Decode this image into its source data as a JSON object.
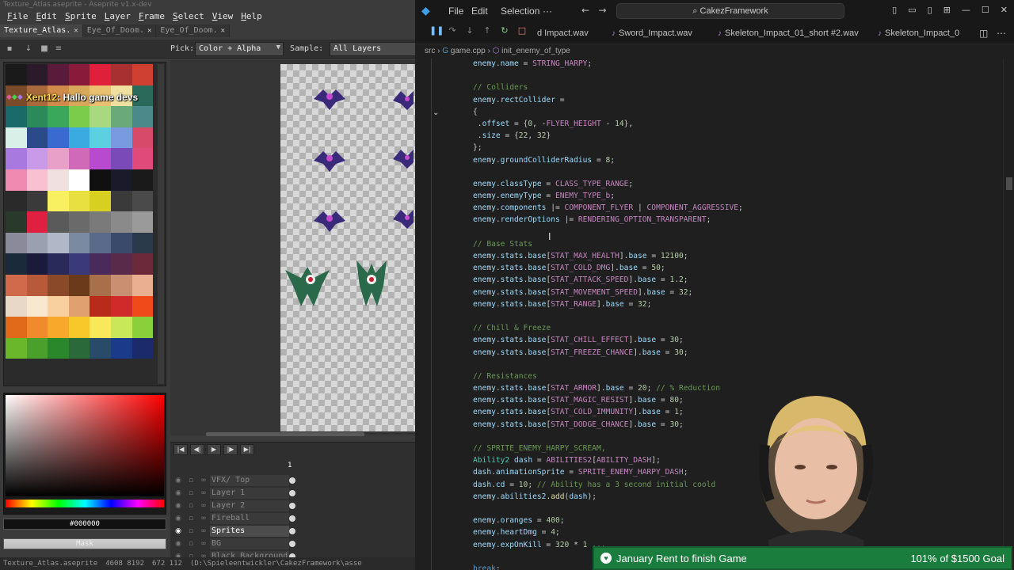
{
  "aseprite": {
    "window_title": "Texture_Atlas.aseprite - Aseprite v1.x-dev",
    "menu": [
      "File",
      "Edit",
      "Sprite",
      "Layer",
      "Frame",
      "Select",
      "View",
      "Help"
    ],
    "tabs": [
      {
        "label": "Texture_Atlas.",
        "active": true
      },
      {
        "label": "Eye_Of_Doom.",
        "active": false
      },
      {
        "label": "Eye_Of_Doom.",
        "active": false
      }
    ],
    "toolbar": {
      "pick_label": "Pick:",
      "pick_value": "Color + Alpha",
      "sample_label": "Sample:",
      "sample_value": "All Layers"
    },
    "palette": [
      "#1a1a1a",
      "#2a1a2a",
      "#5a1a3a",
      "#8a1a3a",
      "#e0203a",
      "#a83030",
      "#d04030",
      "#7a4a2a",
      "#a86a3a",
      "#d08a4a",
      "#d8a85a",
      "#e8c070",
      "#f0e0a0",
      "#2a6a5a",
      "#1a6a6a",
      "#2a8a5a",
      "#3aa85a",
      "#7acc4a",
      "#a8d880",
      "#6aaa7a",
      "#4a8a8a",
      "#d8f0e8",
      "#2a4a8a",
      "#3a6ad0",
      "#3aaae0",
      "#5ad0e0",
      "#7a9ae0",
      "#d84a6a",
      "#a87ae0",
      "#c89ae8",
      "#e8a0c8",
      "#d06ab8",
      "#b84ad0",
      "#7a4ab8",
      "#e04a7a",
      "#f08ab0",
      "#f8c0d0",
      "#f0e0e0",
      "#ffffff",
      "#101010",
      "#1a1a2a",
      "#1a1a1a",
      "#2a2a2a",
      "#3a3a3a",
      "#f8f060",
      "#e8e040",
      "#d8d020",
      "#3a3a3a",
      "#4a4a4a",
      "#2a3a2a",
      "#e02040",
      "#5a5a5a",
      "#6a6a6a",
      "#7a7a7a",
      "#8a8a8a",
      "#9a9a9a",
      "#8a8a9a",
      "#9aa0b0",
      "#b0b8c8",
      "#7a8aa0",
      "#5a6a8a",
      "#3a4a6a",
      "#2a3a4a",
      "#1a2a3a",
      "#1a1a3a",
      "#2a2a5a",
      "#3a3a7a",
      "#4a2a5a",
      "#5a2a4a",
      "#6a2a3a",
      "#d06a4a",
      "#b85a3a",
      "#8a4a2a",
      "#6a3a1a",
      "#a8704a",
      "#c89070",
      "#e8b090",
      "#e8d8c8",
      "#f8e8d0",
      "#f8d0a0",
      "#e0a070",
      "#b82a1a",
      "#d02a2a",
      "#f04a1a",
      "#e06a1a",
      "#f08a2a",
      "#f8a82a",
      "#f8c82a",
      "#f8e85a",
      "#c8e85a",
      "#8ad03a",
      "#6ab82a",
      "#4aa02a",
      "#2a882a",
      "#2a6a3a",
      "#2a4a6a",
      "#1a3a8a",
      "#1a2a6a"
    ],
    "chat": {
      "user": "Xent12",
      "message": ": Hallo game devs"
    },
    "color_hex": "#000000",
    "mask_label": "Mask",
    "timeline": {
      "frame_number": "1",
      "layers": [
        {
          "name": "VFX/ Top",
          "active": false
        },
        {
          "name": "Layer 1",
          "active": false
        },
        {
          "name": "Layer 2",
          "active": false
        },
        {
          "name": "Fireball",
          "active": false
        },
        {
          "name": "Sprites",
          "active": true
        },
        {
          "name": "BG",
          "active": false
        },
        {
          "name": "Black Background",
          "active": false
        }
      ]
    },
    "status": {
      "file": "Texture_Atlas.aseprite",
      "size": "4608 8192",
      "pos": "672 112",
      "path": "(D:\\Spieleentwickler\\CakezFramework\\asse"
    }
  },
  "vscode": {
    "menu": [
      "File",
      "Edit",
      "Selection",
      "···"
    ],
    "search": "CakezFramework",
    "tabs": [
      "d Impact.wav",
      "Sword_Impact.wav",
      "Skeleton_Impact_01_short #2.wav",
      "Skeleton_Impact_0"
    ],
    "breadcrumb": {
      "folder": "src",
      "file": "game.cpp",
      "symbol": "init_enemy_of_type"
    },
    "code_lines": [
      [
        [
          "c-var",
          "enemy"
        ],
        [
          "",
          "."
        ],
        [
          "c-var",
          "name"
        ],
        [
          "",
          " = "
        ],
        [
          "c-const",
          "STRING_HARPY"
        ],
        [
          "",
          ";"
        ]
      ],
      [],
      [
        [
          "c-com",
          "// Colliders"
        ]
      ],
      [
        [
          "c-var",
          "enemy"
        ],
        [
          "",
          "."
        ],
        [
          "c-var",
          "rectCollider"
        ],
        [
          "",
          " ="
        ]
      ],
      [
        [
          "",
          "{"
        ]
      ],
      [
        [
          "",
          " ."
        ],
        [
          "c-var",
          "offset"
        ],
        [
          "",
          " = {"
        ],
        [
          "c-num",
          "0"
        ],
        [
          "",
          ", -"
        ],
        [
          "c-const",
          "FLYER_HEIGHT"
        ],
        [
          "",
          " - "
        ],
        [
          "c-num",
          "14"
        ],
        [
          "",
          "},"
        ]
      ],
      [
        [
          "",
          " ."
        ],
        [
          "c-var",
          "size"
        ],
        [
          "",
          " = {"
        ],
        [
          "c-num",
          "22"
        ],
        [
          "",
          ", "
        ],
        [
          "c-num",
          "32"
        ],
        [
          "",
          "}"
        ]
      ],
      [
        [
          "",
          "};"
        ]
      ],
      [
        [
          "c-var",
          "enemy"
        ],
        [
          "",
          "."
        ],
        [
          "c-var",
          "groundColliderRadius"
        ],
        [
          "",
          " = "
        ],
        [
          "c-num",
          "8"
        ],
        [
          "",
          ";"
        ]
      ],
      [],
      [
        [
          "c-var",
          "enemy"
        ],
        [
          "",
          "."
        ],
        [
          "c-var",
          "classType"
        ],
        [
          "",
          " = "
        ],
        [
          "c-const",
          "CLASS_TYPE_RANGE"
        ],
        [
          "",
          ";"
        ]
      ],
      [
        [
          "c-var",
          "enemy"
        ],
        [
          "",
          "."
        ],
        [
          "c-var",
          "enemyType"
        ],
        [
          "",
          " = "
        ],
        [
          "c-const",
          "ENEMY_TYPE_b"
        ],
        [
          "",
          ";"
        ]
      ],
      [
        [
          "c-var",
          "enemy"
        ],
        [
          "",
          "."
        ],
        [
          "c-var",
          "components"
        ],
        [
          "",
          " |= "
        ],
        [
          "c-const",
          "COMPONENT_FLYER"
        ],
        [
          "",
          " | "
        ],
        [
          "c-const",
          "COMPONENT_AGGRESSIVE"
        ],
        [
          "",
          ";"
        ]
      ],
      [
        [
          "c-var",
          "enemy"
        ],
        [
          "",
          "."
        ],
        [
          "c-var",
          "renderOptions"
        ],
        [
          "",
          " |= "
        ],
        [
          "c-const",
          "RENDERING_OPTION_TRANSPARENT"
        ],
        [
          "",
          ";"
        ]
      ],
      [],
      [
        [
          "c-com",
          "// Base Stats"
        ]
      ],
      [
        [
          "c-var",
          "enemy"
        ],
        [
          "",
          "."
        ],
        [
          "c-var",
          "stats"
        ],
        [
          "",
          "."
        ],
        [
          "c-var",
          "base"
        ],
        [
          "",
          "["
        ],
        [
          "c-const",
          "STAT_MAX_HEALTH"
        ],
        [
          "",
          "]."
        ],
        [
          "c-var",
          "base"
        ],
        [
          "",
          " = "
        ],
        [
          "c-num",
          "12100"
        ],
        [
          "",
          ";"
        ]
      ],
      [
        [
          "c-var",
          "enemy"
        ],
        [
          "",
          "."
        ],
        [
          "c-var",
          "stats"
        ],
        [
          "",
          "."
        ],
        [
          "c-var",
          "base"
        ],
        [
          "",
          "["
        ],
        [
          "c-const",
          "STAT_COLD_DMG"
        ],
        [
          "",
          "]."
        ],
        [
          "c-var",
          "base"
        ],
        [
          "",
          " = "
        ],
        [
          "c-num",
          "50"
        ],
        [
          "",
          ";"
        ]
      ],
      [
        [
          "c-var",
          "enemy"
        ],
        [
          "",
          "."
        ],
        [
          "c-var",
          "stats"
        ],
        [
          "",
          "."
        ],
        [
          "c-var",
          "base"
        ],
        [
          "",
          "["
        ],
        [
          "c-const",
          "STAT_ATTACK_SPEED"
        ],
        [
          "",
          "]."
        ],
        [
          "c-var",
          "base"
        ],
        [
          "",
          " = "
        ],
        [
          "c-num",
          "1.2"
        ],
        [
          "",
          ";"
        ]
      ],
      [
        [
          "c-var",
          "enemy"
        ],
        [
          "",
          "."
        ],
        [
          "c-var",
          "stats"
        ],
        [
          "",
          "."
        ],
        [
          "c-var",
          "base"
        ],
        [
          "",
          "["
        ],
        [
          "c-const",
          "STAT_MOVEMENT_SPEED"
        ],
        [
          "",
          "]."
        ],
        [
          "c-var",
          "base"
        ],
        [
          "",
          " = "
        ],
        [
          "c-num",
          "32"
        ],
        [
          "",
          ";"
        ]
      ],
      [
        [
          "c-var",
          "enemy"
        ],
        [
          "",
          "."
        ],
        [
          "c-var",
          "stats"
        ],
        [
          "",
          "."
        ],
        [
          "c-var",
          "base"
        ],
        [
          "",
          "["
        ],
        [
          "c-const",
          "STAT_RANGE"
        ],
        [
          "",
          "]."
        ],
        [
          "c-var",
          "base"
        ],
        [
          "",
          " = "
        ],
        [
          "c-num",
          "32"
        ],
        [
          "",
          ";"
        ]
      ],
      [],
      [
        [
          "c-com",
          "// Chill & Freeze"
        ]
      ],
      [
        [
          "c-var",
          "enemy"
        ],
        [
          "",
          "."
        ],
        [
          "c-var",
          "stats"
        ],
        [
          "",
          "."
        ],
        [
          "c-var",
          "base"
        ],
        [
          "",
          "["
        ],
        [
          "c-const",
          "STAT_CHILL_EFFECT"
        ],
        [
          "",
          "]."
        ],
        [
          "c-var",
          "base"
        ],
        [
          "",
          " = "
        ],
        [
          "c-num",
          "30"
        ],
        [
          "",
          ";"
        ]
      ],
      [
        [
          "c-var",
          "enemy"
        ],
        [
          "",
          "."
        ],
        [
          "c-var",
          "stats"
        ],
        [
          "",
          "."
        ],
        [
          "c-var",
          "base"
        ],
        [
          "",
          "["
        ],
        [
          "c-const",
          "STAT_FREEZE_CHANCE"
        ],
        [
          "",
          "]."
        ],
        [
          "c-var",
          "base"
        ],
        [
          "",
          " = "
        ],
        [
          "c-num",
          "30"
        ],
        [
          "",
          ";"
        ]
      ],
      [],
      [
        [
          "c-com",
          "// Resistances"
        ]
      ],
      [
        [
          "c-var",
          "enemy"
        ],
        [
          "",
          "."
        ],
        [
          "c-var",
          "stats"
        ],
        [
          "",
          "."
        ],
        [
          "c-var",
          "base"
        ],
        [
          "",
          "["
        ],
        [
          "c-const",
          "STAT_ARMOR"
        ],
        [
          "",
          "]."
        ],
        [
          "c-var",
          "base"
        ],
        [
          "",
          " = "
        ],
        [
          "c-num",
          "20"
        ],
        [
          "",
          "; "
        ],
        [
          "c-com",
          "// % Reduction"
        ]
      ],
      [
        [
          "c-var",
          "enemy"
        ],
        [
          "",
          "."
        ],
        [
          "c-var",
          "stats"
        ],
        [
          "",
          "."
        ],
        [
          "c-var",
          "base"
        ],
        [
          "",
          "["
        ],
        [
          "c-const",
          "STAT_MAGIC_RESIST"
        ],
        [
          "",
          "]."
        ],
        [
          "c-var",
          "base"
        ],
        [
          "",
          " = "
        ],
        [
          "c-num",
          "80"
        ],
        [
          "",
          ";"
        ]
      ],
      [
        [
          "c-var",
          "enemy"
        ],
        [
          "",
          "."
        ],
        [
          "c-var",
          "stats"
        ],
        [
          "",
          "."
        ],
        [
          "c-var",
          "base"
        ],
        [
          "",
          "["
        ],
        [
          "c-const",
          "STAT_COLD_IMMUNITY"
        ],
        [
          "",
          "]."
        ],
        [
          "c-var",
          "base"
        ],
        [
          "",
          " = "
        ],
        [
          "c-num",
          "1"
        ],
        [
          "",
          ";"
        ]
      ],
      [
        [
          "c-var",
          "enemy"
        ],
        [
          "",
          "."
        ],
        [
          "c-var",
          "stats"
        ],
        [
          "",
          "."
        ],
        [
          "c-var",
          "base"
        ],
        [
          "",
          "["
        ],
        [
          "c-const",
          "STAT_DODGE_CHANCE"
        ],
        [
          "",
          "]."
        ],
        [
          "c-var",
          "base"
        ],
        [
          "",
          " = "
        ],
        [
          "c-num",
          "30"
        ],
        [
          "",
          ";"
        ]
      ],
      [],
      [
        [
          "c-com",
          "// SPRITE_ENEMY_HARPY_SCREAM,"
        ]
      ],
      [
        [
          "c-type",
          "Ability2"
        ],
        [
          "",
          " "
        ],
        [
          "c-var",
          "dash"
        ],
        [
          "",
          " = "
        ],
        [
          "c-const",
          "ABILITIES2"
        ],
        [
          "",
          "["
        ],
        [
          "c-const",
          "ABILITY_DASH"
        ],
        [
          "",
          "];"
        ]
      ],
      [
        [
          "c-var",
          "dash"
        ],
        [
          "",
          "."
        ],
        [
          "c-var",
          "animationSprite"
        ],
        [
          "",
          " = "
        ],
        [
          "c-const",
          "SPRITE_ENEMY_HARPY_DASH"
        ],
        [
          "",
          ";"
        ]
      ],
      [
        [
          "c-var",
          "dash"
        ],
        [
          "",
          "."
        ],
        [
          "c-var",
          "cd"
        ],
        [
          "",
          " = "
        ],
        [
          "c-num",
          "10"
        ],
        [
          "",
          "; "
        ],
        [
          "c-com",
          "// Ability has a 3 second initial coold"
        ]
      ],
      [
        [
          "c-var",
          "enemy"
        ],
        [
          "",
          "."
        ],
        [
          "c-var",
          "abilities2"
        ],
        [
          "",
          "."
        ],
        [
          "c-fn",
          "add"
        ],
        [
          "",
          "("
        ],
        [
          "c-var",
          "dash"
        ],
        [
          "",
          ");"
        ]
      ],
      [],
      [
        [
          "c-var",
          "enemy"
        ],
        [
          "",
          "."
        ],
        [
          "c-var",
          "oranges"
        ],
        [
          "",
          " = "
        ],
        [
          "c-num",
          "400"
        ],
        [
          "",
          ";"
        ]
      ],
      [
        [
          "c-var",
          "enemy"
        ],
        [
          "",
          "."
        ],
        [
          "c-var",
          "heartDmg"
        ],
        [
          "",
          " = "
        ],
        [
          "c-num",
          "4"
        ],
        [
          "",
          ";"
        ]
      ],
      [
        [
          "c-var",
          "enemy"
        ],
        [
          "",
          "."
        ],
        [
          "c-var",
          "expOnKill"
        ],
        [
          "",
          " = "
        ],
        [
          "c-num",
          "320"
        ],
        [
          "",
          " * "
        ],
        [
          "c-num",
          "1"
        ],
        [
          "",
          " ..."
        ]
      ],
      [],
      [
        [
          "c-kw",
          "break"
        ],
        [
          "",
          ";"
        ]
      ]
    ]
  },
  "overlay": {
    "donation_goal": "January Rent to finish Game",
    "donation_progress": "101% of $1500 Goal"
  }
}
